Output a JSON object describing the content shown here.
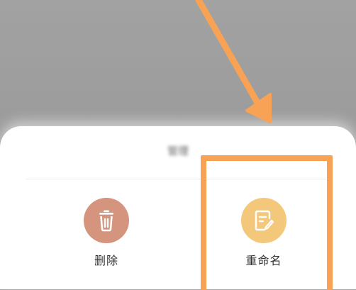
{
  "sheet": {
    "title": "管理"
  },
  "actions": [
    {
      "label": "删除",
      "icon": "trash-icon",
      "color": "#d4947e"
    },
    {
      "label": "重命名",
      "icon": "edit-document-icon",
      "color": "#f3c87b"
    }
  ],
  "annotation": {
    "color": "#f7a255"
  }
}
